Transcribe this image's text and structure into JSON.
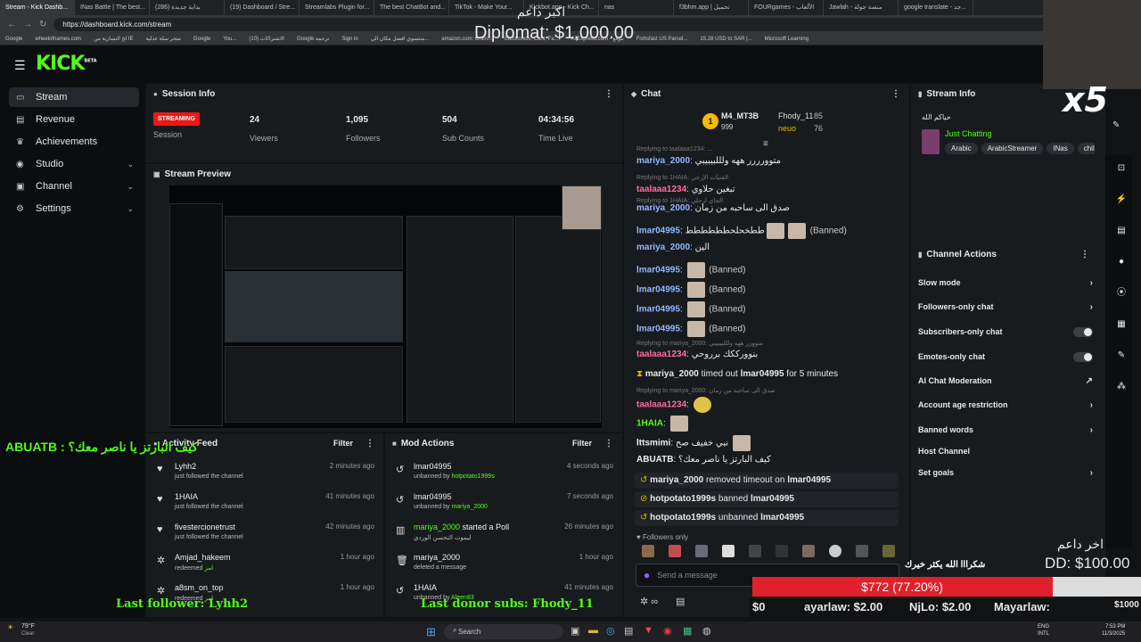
{
  "browser": {
    "tabs": [
      "Stream - Kick Dashb...",
      "INas Battle | The best...",
      "بداية جديدة (286)",
      "(19) Dashboard / Stre...",
      "Streamlabs Plugin for...",
      "The best ChatBot and...",
      "TikTok - Make Your...",
      "Kickbot.app - Kick Ch...",
      "nas",
      "f3bhm.app | تحميل",
      "FOURgames - الألعاب",
      "Jawlah - منصة جولة",
      "google translate - جد..."
    ],
    "url": "https://dashboard.kick.com/stream",
    "bookmarks": [
      "Google",
      "wheelofnames.com",
      "لخ التسارية من IE",
      "متجر سلة عدلية",
      "Google",
      "You...",
      "الاشتراكات (10)",
      "Google ترجمة",
      "Sign in",
      "منتسوي افضل مكان الي...",
      "amazon.com: Onlin...",
      "Electronics, Cars, Fa...",
      "AliExpress.com - موقع",
      "Fishsfast US Parcel...",
      "15.28 USD to SAR |...",
      "Microsoft Learning"
    ]
  },
  "header": {
    "logo": "KICK",
    "logo_sup": "BETA"
  },
  "sidebar": {
    "items": [
      {
        "label": "Stream",
        "icon": "stream-icon"
      },
      {
        "label": "Revenue",
        "icon": "revenue-icon"
      },
      {
        "label": "Achievements",
        "icon": "trophy-icon"
      },
      {
        "label": "Studio",
        "icon": "studio-icon"
      },
      {
        "label": "Channel",
        "icon": "channel-icon"
      },
      {
        "label": "Settings",
        "icon": "gear-icon"
      }
    ]
  },
  "session": {
    "title": "Session Info",
    "badge": "STREAMING",
    "badge_label": "Session",
    "stats": [
      {
        "value": "24",
        "label": "Viewers"
      },
      {
        "value": "1,095",
        "label": "Followers"
      },
      {
        "value": "504",
        "label": "Sub Counts"
      },
      {
        "value": "04:34:56",
        "label": "Time Live"
      }
    ]
  },
  "preview": {
    "title": "Stream Preview"
  },
  "activity": {
    "title": "Activity Feed",
    "filter": "Filter",
    "items": [
      {
        "user": "Lyhh2",
        "action": "just followed the channel",
        "time": "2 minutes ago"
      },
      {
        "user": "1HAIA",
        "action": "just followed the channel",
        "time": "41 minutes ago"
      },
      {
        "user": "fivestercionetrust",
        "action": "just followed the channel",
        "time": "42 minutes ago"
      },
      {
        "user": "Amjad_hakeem",
        "action": "redeemed",
        "reward": "امر",
        "time": "1 hour ago"
      },
      {
        "user": "a8sm_on_top",
        "action": "redeemed",
        "reward": "امر",
        "time": "1 hour ago"
      }
    ]
  },
  "mod": {
    "title": "Mod Actions",
    "filter": "Filter",
    "items": [
      {
        "user": "lmar04995",
        "action": "unbanned by",
        "by": "hotpotato1999s",
        "time": "4 seconds ago"
      },
      {
        "user": "lmar04995",
        "action": "unbanned by",
        "by": "mariya_2000",
        "time": "7 seconds ago"
      },
      {
        "user": "mariya_2000",
        "action": "started a Poll",
        "sub": "ليموت التحسن الوردي",
        "time": "26 minutes ago"
      },
      {
        "user": "mariya_2000",
        "action": "deleted a message",
        "time": "1 hour ago"
      },
      {
        "user": "1HAIA",
        "action": "unbanned by",
        "by": "Aleen83",
        "time": "41 minutes ago"
      }
    ]
  },
  "chat": {
    "title": "Chat",
    "pinned": {
      "top_user": "M4_MT3B",
      "top_count": "999",
      "u2": "Fhody_11",
      "u2_count": "85",
      "u3": "neuo",
      "u3_count": "76"
    },
    "lines": [
      {
        "kind": "reply",
        "text": "Replying to taalaaa1234: ..."
      },
      {
        "kind": "msg",
        "user": "mariya_2000",
        "text": "متوورررر ههه ولللبيبيبي",
        "color": "blue"
      },
      {
        "kind": "reply",
        "text": "Replying to 1HAIA: الفتيات الإرجي"
      },
      {
        "kind": "msg",
        "user": "taalaaa1234",
        "text": "تبغين حلاوي",
        "color": "pink"
      },
      {
        "kind": "reply",
        "text": "Replying to 1HAIA: الجاي ارحلي"
      },
      {
        "kind": "msg",
        "user": "mariya_2000",
        "text": "صدق الى ساحبه من زمان",
        "color": "blue"
      },
      {
        "kind": "msg",
        "user": "lmar04995",
        "text": "ططخحلحطططططط",
        "banned": "(Banned)",
        "color": "blue"
      },
      {
        "kind": "msg",
        "user": "mariya_2000",
        "text": "الين",
        "color": "blue"
      },
      {
        "kind": "msg",
        "user": "lmar04995",
        "text": "",
        "banned": "(Banned)",
        "color": "blue"
      },
      {
        "kind": "msg",
        "user": "lmar04995",
        "text": "",
        "banned": "(Banned)",
        "color": "blue"
      },
      {
        "kind": "msg",
        "user": "lmar04995",
        "text": "",
        "banned": "(Banned)",
        "color": "blue"
      },
      {
        "kind": "msg",
        "user": "lmar04995",
        "text": "",
        "banned": "(Banned)",
        "color": "blue"
      },
      {
        "kind": "reply",
        "text": "Replying to mariya_2000: متوورر ههه ولللبيبيبي"
      },
      {
        "kind": "msg",
        "user": "taalaaa1234",
        "text": "بنوورككك برروحي",
        "color": "pink"
      }
    ],
    "timeout": {
      "user": "mariya_2000",
      "text": "timed out",
      "target": "lmar04995",
      "duration": "for 5 minutes"
    },
    "lines2": [
      {
        "kind": "reply",
        "text": "Replying to mariya_2000: صدق الى ساحبه من زمان"
      },
      {
        "kind": "msg",
        "user": "taalaaa1234",
        "text": "",
        "color": "pink"
      },
      {
        "kind": "msg",
        "user": "1HAIA",
        "text": "",
        "color": "green"
      },
      {
        "kind": "msg",
        "user": "lttsmimi",
        "text": "نبي خفيف صح",
        "color": "white"
      },
      {
        "kind": "msg",
        "user": "ABUATB",
        "text": "كيف البارتز يا ناصر معك؟",
        "color": "white"
      }
    ],
    "system": [
      {
        "user": "mariya_2000",
        "text": "removed timeout on",
        "target": "lmar04995"
      },
      {
        "user": "hotpotato1999s",
        "text": "banned",
        "target": "lmar04995"
      },
      {
        "user": "hotpotato1999s",
        "text": "unbanned",
        "target": "lmar04995"
      }
    ],
    "followers_only": "Followers only",
    "placeholder": "Send a message"
  },
  "stream_info": {
    "title": "Stream Info",
    "stream_title": "حياكم الله",
    "category": "Just Chatting",
    "tags": [
      "Arabic",
      "ArabicStreamer",
      "INas",
      "chillin"
    ]
  },
  "channel_actions": {
    "title": "Channel Actions",
    "items": [
      {
        "label": "Slow mode",
        "type": "chevron"
      },
      {
        "label": "Followers-only chat",
        "type": "chevron"
      },
      {
        "label": "Subscribers-only chat",
        "type": "toggle"
      },
      {
        "label": "Emotes-only chat",
        "type": "toggle"
      },
      {
        "label": "AI Chat Moderation",
        "type": "external"
      },
      {
        "label": "Account age restriction",
        "type": "chevron"
      },
      {
        "label": "Banned words",
        "type": "chevron"
      },
      {
        "label": "Host Channel",
        "type": "none"
      },
      {
        "label": "Set goals",
        "type": "chevron"
      }
    ]
  },
  "overlay": {
    "top_label": "اكبر داعم",
    "top_amount": "Diplomat: $1,000.00",
    "x5": "x5",
    "chat_msg": "ABUATB : كيف البارتز يا ناصر معك؟",
    "last_follower": "Last follower: Lyhh2",
    "last_donor": "Last donor subs: Fhody_11",
    "last_donor_label": "اخر داعم",
    "last_donor_amount": "DD: $100.00",
    "goal_text": "$772 (77.20%)",
    "goal_fraction": 0.772,
    "thanks": "شكرااا الله يكثر خيرك",
    "ticker": [
      "$0",
      "ayarlaw: $2.00",
      "NjLo: $2.00",
      "Mayarlaw:",
      "$1000"
    ],
    "goal_min": "$0"
  },
  "taskbar": {
    "weather": "79°F",
    "weather_sub": "Clear",
    "search": "Search",
    "lang": "ENG",
    "lang2": "INTL",
    "time": "7:53 PM",
    "date": "11/3/2025"
  },
  "colors": {
    "accent": "#53fc18",
    "streaming": "#e91916",
    "bg": "#101214",
    "panel": "#181b1e"
  }
}
